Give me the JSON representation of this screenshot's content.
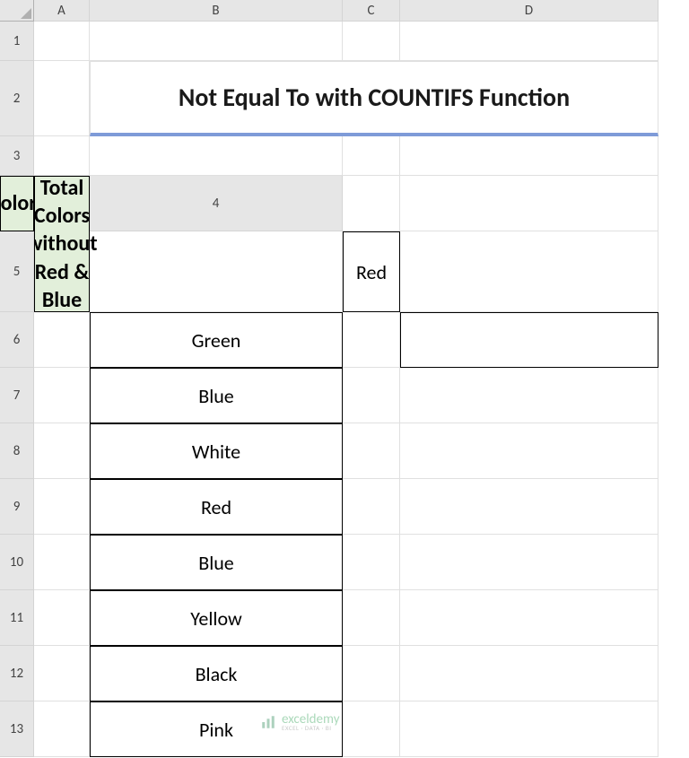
{
  "columns": [
    "",
    "A",
    "B",
    "C",
    "D"
  ],
  "rows": [
    "1",
    "2",
    "3",
    "4",
    "5",
    "6",
    "7",
    "8",
    "9",
    "10",
    "11",
    "12",
    "13"
  ],
  "title": "Not Equal To with COUNTIFS Function",
  "tableHeader": "Colors",
  "colorsData": [
    "Red",
    "Green",
    "Blue",
    "White",
    "Red",
    "Blue",
    "Yellow",
    "Black",
    "Pink"
  ],
  "resultHeader": "Total Colors without Red & Blue",
  "resultValue": "",
  "watermark": {
    "name": "exceldemy",
    "tagline": "EXCEL · DATA · BI"
  }
}
